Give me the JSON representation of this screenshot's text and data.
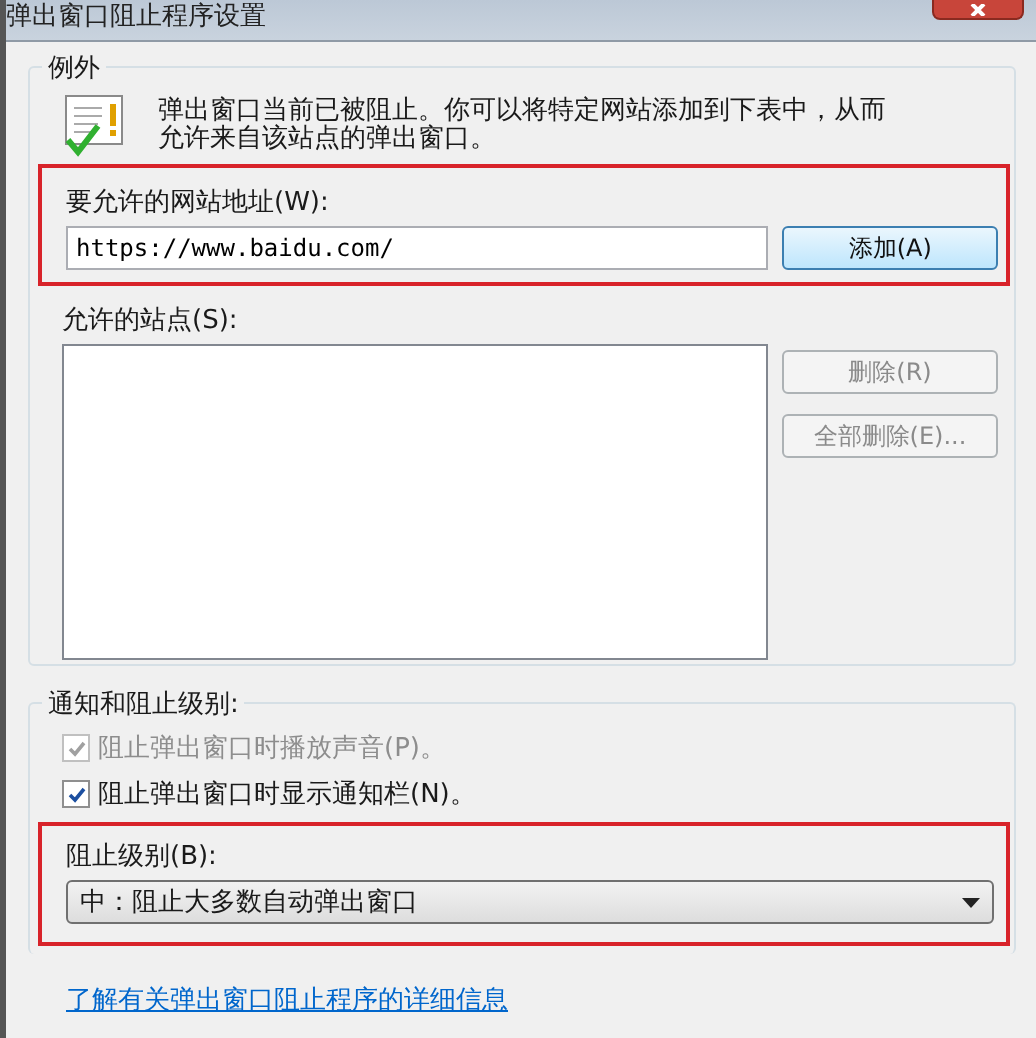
{
  "window": {
    "title": "弹出窗口阻止程序设置"
  },
  "exceptions": {
    "title": "例外",
    "message": "弹出窗口当前已被阻止。你可以将特定网站添加到下表中，从而允许来自该站点的弹出窗口。",
    "address_label": "要允许的网站地址(W):",
    "address_value": "https://www.baidu.com/",
    "add_button": {
      "label": "添加(A)",
      "disabled": false
    },
    "sites_label": "允许的站点(S):",
    "buttons": [
      {
        "label": "删除(R)",
        "disabled": true
      },
      {
        "label": "全部删除(E)...",
        "disabled": true
      }
    ]
  },
  "notifications": {
    "title": "通知和阻止级别:",
    "options": [
      {
        "label": "阻止弹出窗口时播放声音(P)。",
        "checked": true,
        "disabled": true
      },
      {
        "label": "阻止弹出窗口时显示通知栏(N)。",
        "checked": true,
        "disabled": false
      }
    ],
    "level_label": "阻止级别(B):",
    "level_value": "中：阻止大多数自动弹出窗口"
  },
  "link": "了解有关弹出窗口阻止程序的详细信息"
}
